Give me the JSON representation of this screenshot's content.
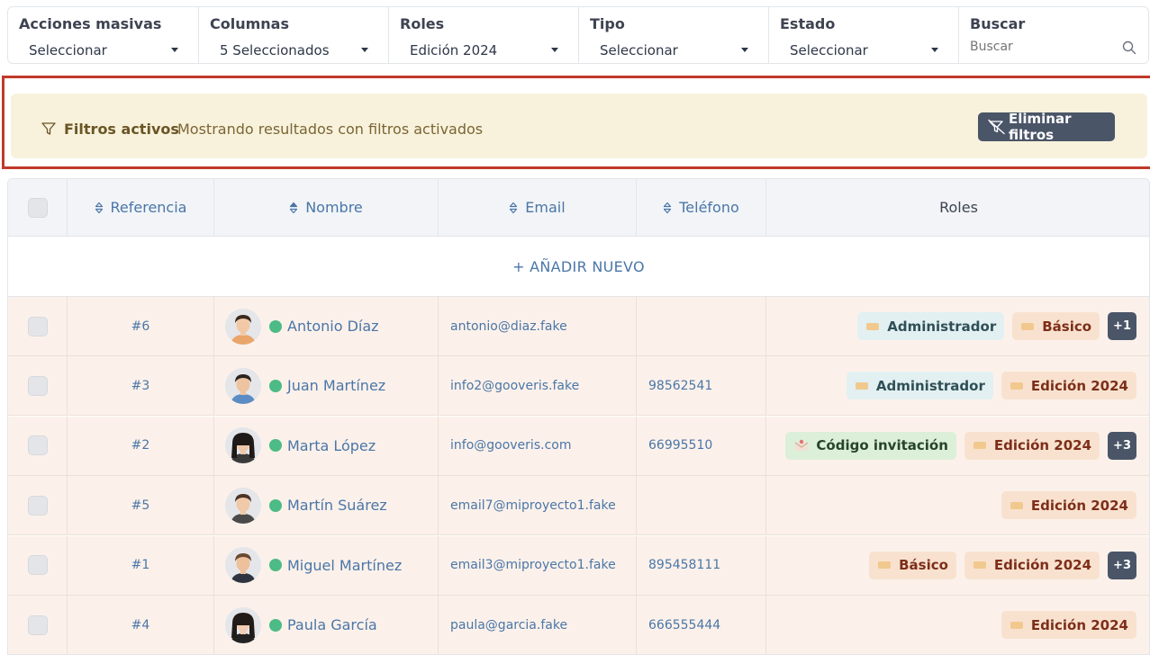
{
  "filters": [
    {
      "label": "Acciones masivas",
      "value": "Seleccionar"
    },
    {
      "label": "Columnas",
      "value": "5 Seleccionados"
    },
    {
      "label": "Roles",
      "value": "Edición 2024"
    },
    {
      "label": "Tipo",
      "value": "Seleccionar"
    },
    {
      "label": "Estado",
      "value": "Seleccionar"
    }
  ],
  "search": {
    "label": "Buscar",
    "placeholder": "Buscar"
  },
  "banner": {
    "title": "Filtros activos",
    "description": "Mostrando resultados con filtros activados",
    "clear_label": "Eliminar filtros"
  },
  "table": {
    "headers": {
      "reference": "Referencia",
      "name": "Nombre",
      "email": "Email",
      "phone": "Teléfono",
      "roles": "Roles"
    },
    "add_new_label": "+ AÑADIR NUEVO",
    "rows": [
      {
        "ref": "#6",
        "name": "Antonio Díaz",
        "email": "antonio@diaz.fake",
        "phone": "",
        "roles": [
          "Administrador",
          "Básico"
        ],
        "more": "+1"
      },
      {
        "ref": "#3",
        "name": "Juan Martínez",
        "email": "info2@gooveris.fake",
        "phone": "98562541",
        "roles": [
          "Administrador",
          "Edición 2024"
        ],
        "more": ""
      },
      {
        "ref": "#2",
        "name": "Marta López",
        "email": "info@gooveris.com",
        "phone": "66995510",
        "roles": [
          "Código invitación",
          "Edición 2024"
        ],
        "more": "+3"
      },
      {
        "ref": "#5",
        "name": "Martín Suárez",
        "email": "email7@miproyecto1.fake",
        "phone": "",
        "roles": [
          "Edición 2024"
        ],
        "more": ""
      },
      {
        "ref": "#1",
        "name": "Miguel Martínez",
        "email": "email3@miproyecto1.fake",
        "phone": "895458111",
        "roles": [
          "Básico",
          "Edición 2024"
        ],
        "more": "+3"
      },
      {
        "ref": "#4",
        "name": "Paula García",
        "email": "paula@garcia.fake",
        "phone": "666555444",
        "roles": [
          "Edición 2024"
        ],
        "more": ""
      }
    ]
  },
  "colors": {
    "accent": "#4a76a8",
    "status_online": "#4cbb85",
    "banner_bg": "#f8f2dc",
    "row_bg": "#fcf1ea",
    "dark_button": "#4a5568"
  }
}
